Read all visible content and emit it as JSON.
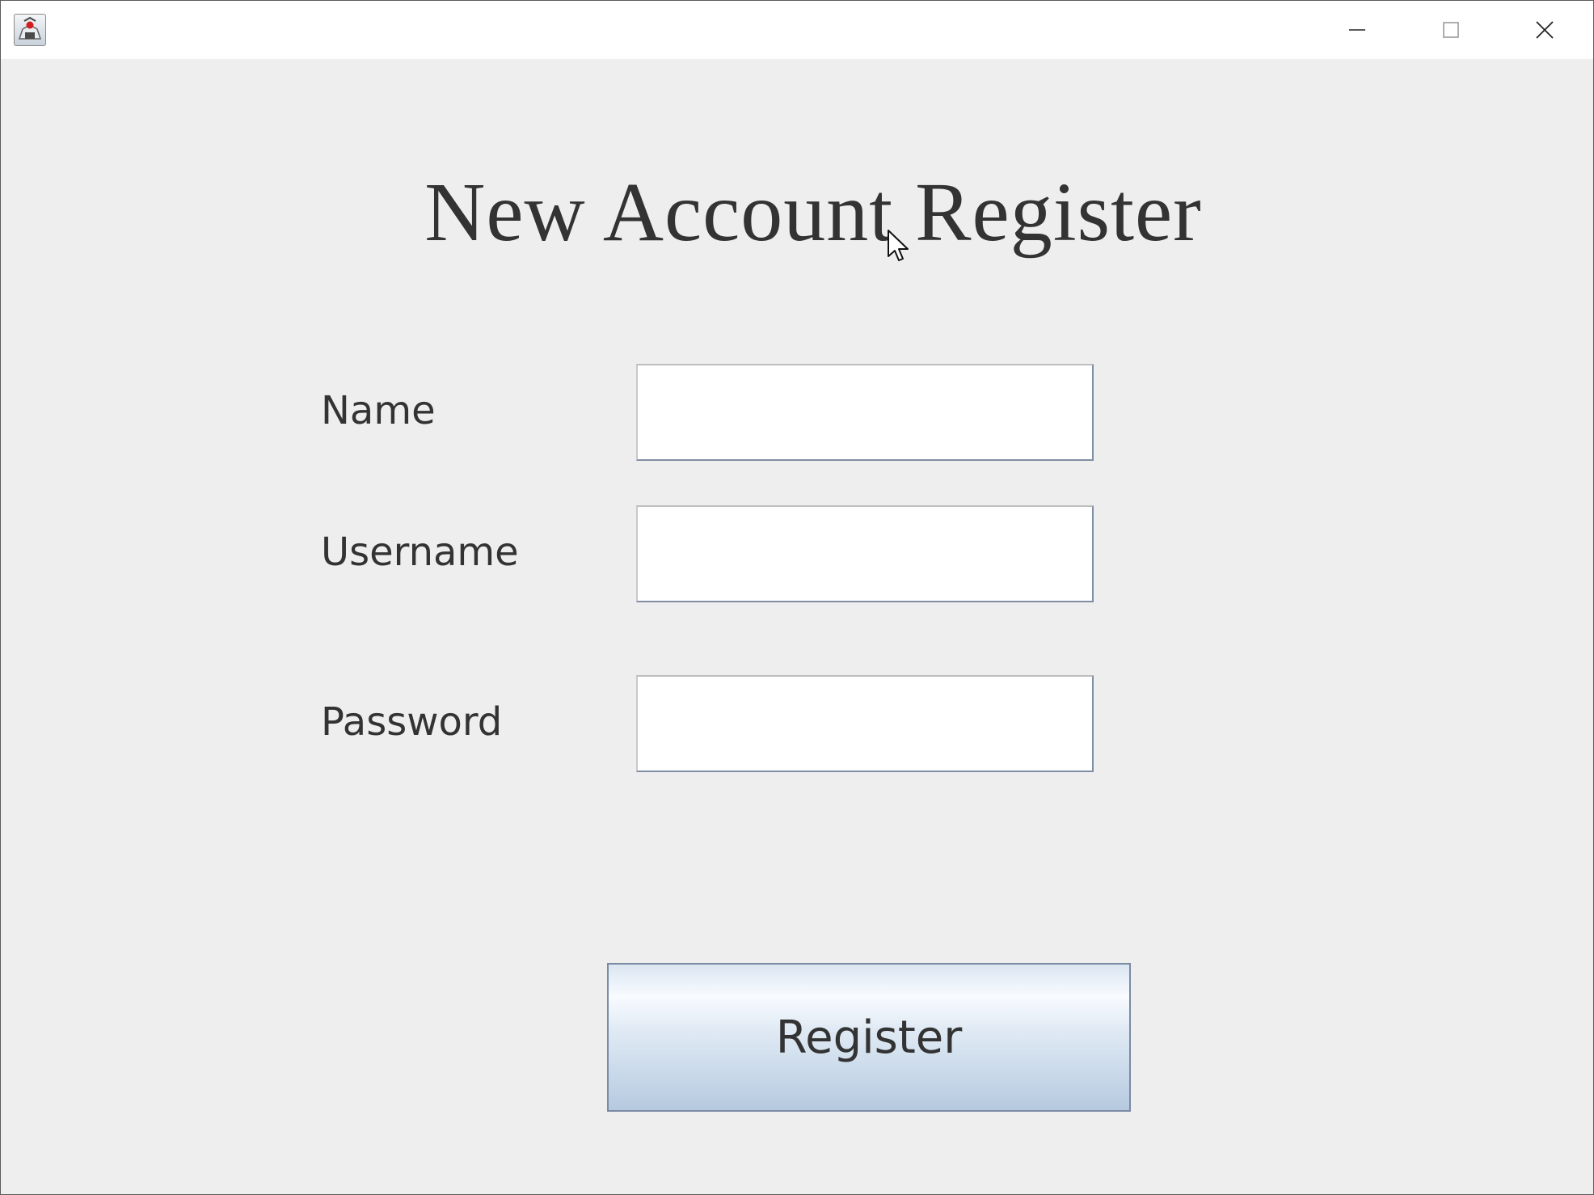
{
  "window": {
    "title": "",
    "controls": {
      "minimize_icon": "minimize-icon",
      "maximize_icon": "maximize-icon",
      "close_icon": "close-icon"
    }
  },
  "form": {
    "title": "New Account Register",
    "fields": [
      {
        "label": "Name",
        "value": ""
      },
      {
        "label": "Username",
        "value": ""
      },
      {
        "label": "Password",
        "value": ""
      }
    ],
    "submit_label": "Register"
  },
  "colors": {
    "background": "#eeeeee",
    "text": "#333333",
    "input_background": "#ffffff",
    "button_gradient_top": "#f8fbff",
    "button_gradient_bottom": "#b6c9de"
  }
}
